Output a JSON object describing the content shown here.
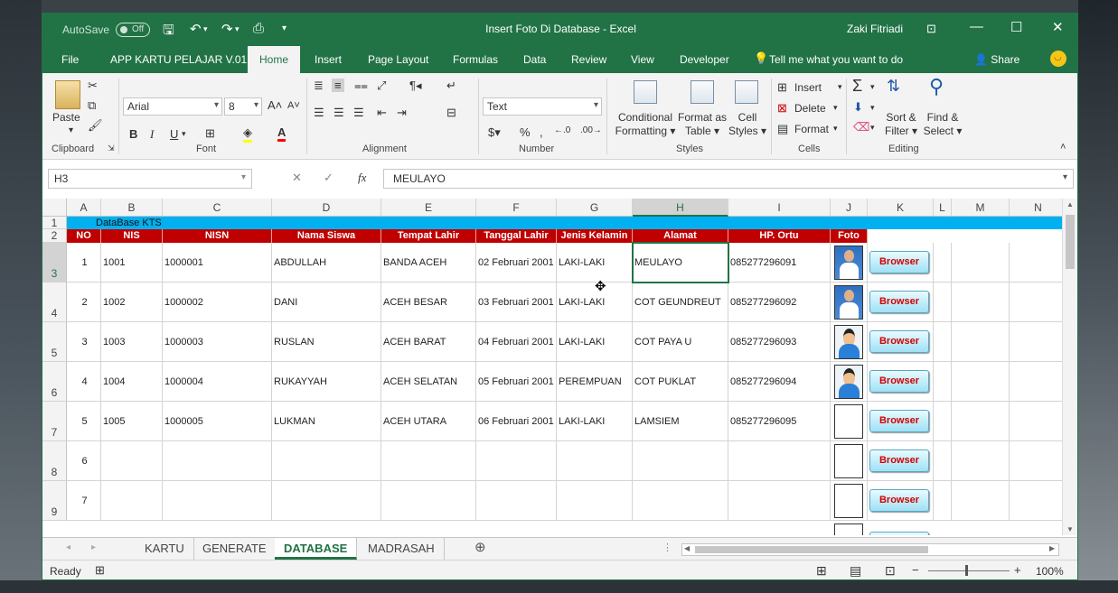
{
  "window": {
    "autosave_label": "AutoSave",
    "autosave_state": "Off",
    "title": "Insert Foto Di Database  -  Excel",
    "user": "Zaki Fitriadi"
  },
  "tabs": [
    "File",
    "APP KARTU PELAJAR V.01",
    "Home",
    "Insert",
    "Page Layout",
    "Formulas",
    "Data",
    "Review",
    "View",
    "Developer"
  ],
  "tell_me": "Tell me what you want to do",
  "share": "Share",
  "ribbon": {
    "clipboard": {
      "label": "Clipboard",
      "paste": "Paste"
    },
    "font": {
      "label": "Font",
      "name": "Arial",
      "size": "8",
      "bold": "B",
      "italic": "I",
      "underline": "U"
    },
    "alignment": {
      "label": "Alignment"
    },
    "number": {
      "label": "Number",
      "format": "Text"
    },
    "styles": {
      "label": "Styles",
      "conditional_1": "Conditional",
      "conditional_2": "Formatting",
      "format_table_1": "Format as",
      "format_table_2": "Table",
      "cell_styles_1": "Cell",
      "cell_styles_2": "Styles"
    },
    "cells": {
      "label": "Cells",
      "insert": "Insert",
      "delete": "Delete",
      "format": "Format"
    },
    "editing": {
      "label": "Editing",
      "sort_1": "Sort &",
      "sort_2": "Filter",
      "find_1": "Find &",
      "find_2": "Select"
    }
  },
  "formula_bar": {
    "name_box": "H3",
    "fx": "fx",
    "value": "MEULAYO"
  },
  "columns": [
    "A",
    "B",
    "C",
    "D",
    "E",
    "F",
    "G",
    "H",
    "I",
    "J",
    "K",
    "L",
    "M",
    "N"
  ],
  "row_numbers": [
    "1",
    "2",
    "3",
    "4",
    "5",
    "6",
    "7",
    "8",
    "9"
  ],
  "sheet": {
    "banner": "DataBase KTS",
    "headers": [
      "NO",
      "NIS",
      "NISN",
      "Nama Siswa",
      "Tempat Lahir",
      "Tanggal Lahir",
      "Jenis Kelamin",
      "Alamat",
      "HP. Ortu",
      "Foto"
    ],
    "rows": [
      {
        "no": "1",
        "nis": "1001",
        "nisn": "1000001",
        "nama": "ABDULLAH",
        "tempat": "BANDA ACEH",
        "tanggal": "02 Februari 2001",
        "jk": "LAKI-LAKI",
        "alamat": "MEULAYO",
        "hp": "085277296091",
        "photo": "student-photo"
      },
      {
        "no": "2",
        "nis": "1002",
        "nisn": "1000002",
        "nama": "DANI",
        "tempat": "ACEH BESAR",
        "tanggal": "03 Februari 2001",
        "jk": "LAKI-LAKI",
        "alamat": "COT GEUNDREUT",
        "hp": "085277296092",
        "photo": "student-photo"
      },
      {
        "no": "3",
        "nis": "1003",
        "nisn": "1000003",
        "nama": "RUSLAN",
        "tempat": "ACEH BARAT",
        "tanggal": "04 Februari 2001",
        "jk": "LAKI-LAKI",
        "alamat": "COT PAYA U",
        "hp": "085277296093",
        "photo": "avatar-icon"
      },
      {
        "no": "4",
        "nis": "1004",
        "nisn": "1000004",
        "nama": "RUKAYYAH",
        "tempat": "ACEH SELATAN",
        "tanggal": "05 Februari 2001",
        "jk": "PEREMPUAN",
        "alamat": "COT PUKLAT",
        "hp": "085277296094",
        "photo": "avatar-icon"
      },
      {
        "no": "5",
        "nis": "1005",
        "nisn": "1000005",
        "nama": "LUKMAN",
        "tempat": "ACEH UTARA",
        "tanggal": "06 Februari 2001",
        "jk": "LAKI-LAKI",
        "alamat": "LAMSIEM",
        "hp": "085277296095",
        "photo": ""
      },
      {
        "no": "6",
        "nis": "",
        "nisn": "",
        "nama": "",
        "tempat": "",
        "tanggal": "",
        "jk": "",
        "alamat": "",
        "hp": "",
        "photo": ""
      },
      {
        "no": "7",
        "nis": "",
        "nisn": "",
        "nama": "",
        "tempat": "",
        "tanggal": "",
        "jk": "",
        "alamat": "",
        "hp": "",
        "photo": ""
      }
    ],
    "browse_button": "Browser"
  },
  "sheet_tabs": [
    "KARTU",
    "GENERATE",
    "DATABASE",
    "MADRASAH"
  ],
  "active_sheet": "DATABASE",
  "status": {
    "ready": "Ready",
    "zoom": "100%"
  },
  "colors": {
    "excel_green": "#217346",
    "header_red": "#c00000",
    "banner_blue": "#00b0f0"
  }
}
